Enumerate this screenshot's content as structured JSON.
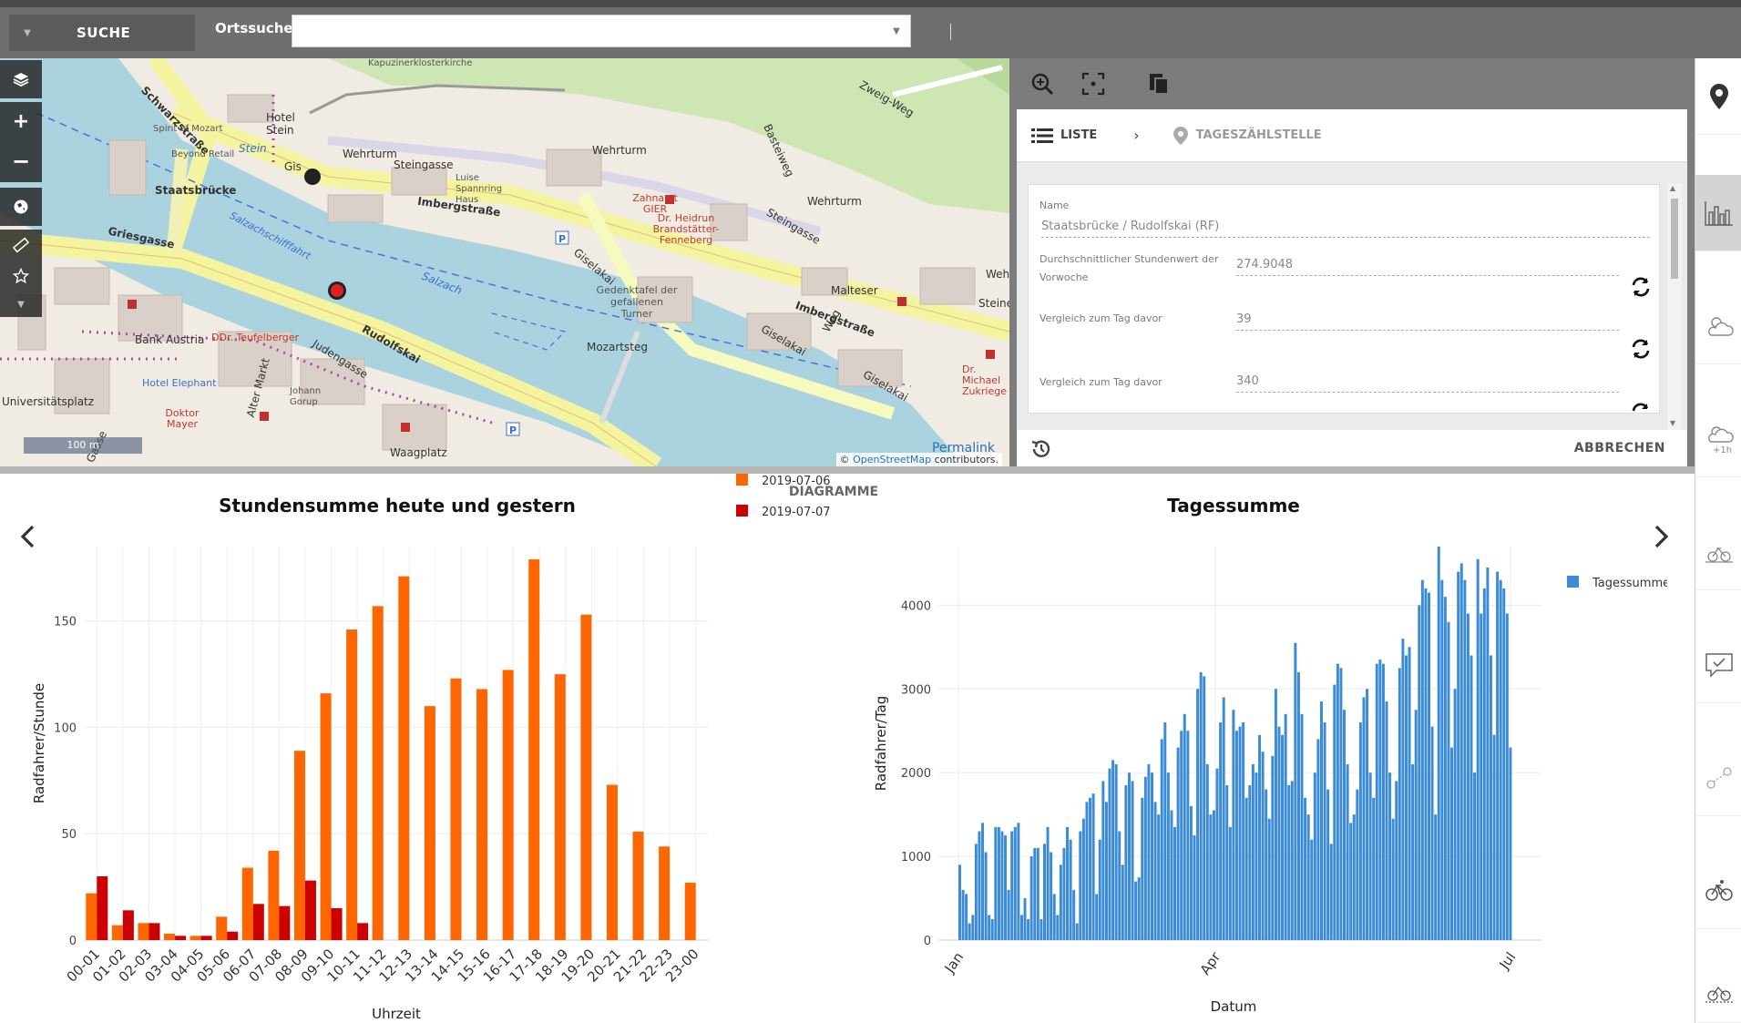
{
  "topbar": {
    "search_label": "SUCHE",
    "place_label": "Ortssuche",
    "place_value": "",
    "place_placeholder": ""
  },
  "map": {
    "labels": {
      "schwarzstrasse": "Schwarzstraße",
      "kapuziner": "Kapuzinerklosterkirche",
      "zweig_weg": "Zweig-Weg",
      "hotel_stein": "Hotel Stein",
      "stein": "Stein",
      "spirit": "Spirit of Mozart",
      "bey": "Beyond Retail",
      "wehrturm1": "Wehrturm",
      "wehrturm2": "Wehrturm",
      "wehrturm3": "Wehrturm",
      "steingasse": "Steingasse",
      "luise": "Luise Spannring Haus",
      "basteiweg": "Basteiweg",
      "staatsbruecke": "Staatsbrücke",
      "imbergstrasse1": "Imbergstraße",
      "zahnarzt": "Zahnarzt GIER",
      "heidrun": "Dr. Heidrun Brandstätter-Fenneberg",
      "steingasse2": "Steingasse",
      "griesgasse": "Griesgasse",
      "salzachschifffahrt": "Salzachschifffahrt",
      "giselakai1": "Giselakai",
      "salzach": "Salzach",
      "gedenktafel": "Gedenktafel der gefallenen Turner",
      "malteser": "Malteser",
      "imbergstrasse2": "Imbergstraße",
      "steine": "Steine",
      "bank_austria": "Bank Austria",
      "teufelberger": "DDr. Teufelberger",
      "rudolfskai": "Rudolfskai",
      "judengasse": "Judengasse",
      "mozartsteg": "Mozartsteg",
      "giselakai2": "Giselakai",
      "weg": "Weg",
      "giselakai3": "Giselakai",
      "michael": "Dr. Michael Zukriege",
      "hotel_elephant": "Hotel Elephant",
      "alter_markt": "Alter Markt",
      "johann": "Johann Gorup",
      "universitaetsplatz": "Universitätsplatz",
      "doktor_mayer": "Doktor Mayer",
      "waagplatz": "Waagplatz",
      "gasse": "Gasse",
      "wehr": "Wehr",
      "gis": "Gis"
    },
    "scale_label": "100 m",
    "permalink": "Permalink",
    "attribution_prefix": "© ",
    "attribution_link": "OpenStreetMap",
    "attribution_suffix": " contributors."
  },
  "panel": {
    "breadcrumb_list": "LISTE",
    "breadcrumb_detail": "TAGESZÄHLSTELLE",
    "fields": [
      {
        "label": "Name",
        "value": "Staatsbrücke / Rudolfskai (RF)"
      },
      {
        "label": "Durchschnittlicher Stundenwert der Vorwoche",
        "value": "274.9048"
      },
      {
        "label": "Vergleich zum Tag davor",
        "value": "39"
      },
      {
        "label": "Vergleich zum Tag davor",
        "value": "340"
      }
    ],
    "cancel_label": "ABBRECHEN"
  },
  "icons": {
    "layers": "layers-icon",
    "zoom_in": "plus-icon",
    "zoom_out": "minus-icon",
    "globe": "globe-icon",
    "measure": "ruler-icon",
    "favorite": "star-icon",
    "zoom_search": "zoom-icon",
    "focus": "focus-icon",
    "copy": "copy-icon"
  },
  "charts_section": {
    "title": "DIAGRAMME"
  },
  "chart_data": [
    {
      "type": "bar",
      "title": "Stundensumme heute und gestern",
      "xlabel": "Uhrzeit",
      "ylabel": "Radfahrer/Stunde",
      "categories": [
        "00-01",
        "01-02",
        "02-03",
        "03-04",
        "04-05",
        "05-06",
        "06-07",
        "07-08",
        "08-09",
        "09-10",
        "10-11",
        "11-12",
        "12-13",
        "13-14",
        "14-15",
        "15-16",
        "16-17",
        "17-18",
        "18-19",
        "19-20",
        "20-21",
        "21-22",
        "22-23",
        "23-00"
      ],
      "series": [
        {
          "name": "2019-07-06",
          "color": "#ff6600",
          "values": [
            22,
            7,
            8,
            3,
            2,
            11,
            34,
            42,
            89,
            116,
            146,
            157,
            171,
            110,
            123,
            118,
            127,
            179,
            125,
            153,
            73,
            51,
            44,
            27
          ]
        },
        {
          "name": "2019-07-07",
          "color": "#cc0000",
          "values": [
            30,
            14,
            8,
            2,
            2,
            4,
            17,
            16,
            28,
            15,
            8,
            0,
            0,
            0,
            0,
            0,
            0,
            0,
            0,
            0,
            0,
            0,
            0,
            0
          ]
        }
      ],
      "yticks": [
        0,
        50,
        100,
        150
      ],
      "ylim": [
        0,
        185
      ],
      "legend": "top-right",
      "grid": true
    },
    {
      "type": "bar",
      "title": "Tagessumme",
      "xlabel": "Datum",
      "ylabel": "Radfahrer/Tag",
      "xticks": [
        "Jan",
        "Apr",
        "Jul"
      ],
      "yticks": [
        0,
        1000,
        2000,
        3000,
        4000
      ],
      "ylim": [
        0,
        4700
      ],
      "series": [
        {
          "name": "Tagessumme",
          "color": "#3b8bd6",
          "values": [
            900,
            600,
            550,
            200,
            300,
            1150,
            1300,
            1400,
            1050,
            300,
            250,
            1350,
            1350,
            1300,
            1250,
            600,
            1300,
            1350,
            1400,
            300,
            500,
            250,
            1000,
            1100,
            1100,
            250,
            1150,
            1350,
            1050,
            550,
            300,
            900,
            1100,
            1350,
            1200,
            600,
            200,
            1300,
            1450,
            1650,
            1700,
            1750,
            550,
            1200,
            1900,
            1650,
            2050,
            2150,
            2100,
            1300,
            900,
            1850,
            2000,
            1900,
            700,
            750,
            1700,
            1950,
            2100,
            2000,
            1650,
            1500,
            2400,
            2600,
            2000,
            1550,
            1350,
            2300,
            2500,
            2700,
            2500,
            1600,
            1250,
            3000,
            3200,
            3150,
            2100,
            1500,
            1550,
            2050,
            2600,
            2900,
            1850,
            1350,
            2750,
            2500,
            2550,
            2600,
            1700,
            1850,
            2100,
            2000,
            2450,
            2250,
            1800,
            1450,
            2200,
            3000,
            2550,
            2450,
            2700,
            1850,
            1900,
            3550,
            3200,
            2700,
            1700,
            1500,
            1200,
            2000,
            2400,
            2850,
            2600,
            1800,
            1150,
            3050,
            3300,
            3250,
            2750,
            2100,
            1400,
            1500,
            1800,
            2600,
            2900,
            3000,
            2000,
            1700,
            3300,
            3350,
            3300,
            2850,
            2000,
            1450,
            1900,
            3250,
            3600,
            3400,
            3500,
            2100,
            2750,
            4000,
            4300,
            4200,
            4150,
            2550,
            1500,
            4700,
            4300,
            4100,
            3800,
            2300,
            3000,
            4400,
            4500,
            4300,
            3900,
            3400,
            2000,
            4550,
            3900,
            4200,
            4450,
            3400,
            2450,
            4400,
            4300,
            4200,
            3900,
            2300
          ]
        }
      ],
      "legend": "top-right",
      "grid": true
    }
  ]
}
